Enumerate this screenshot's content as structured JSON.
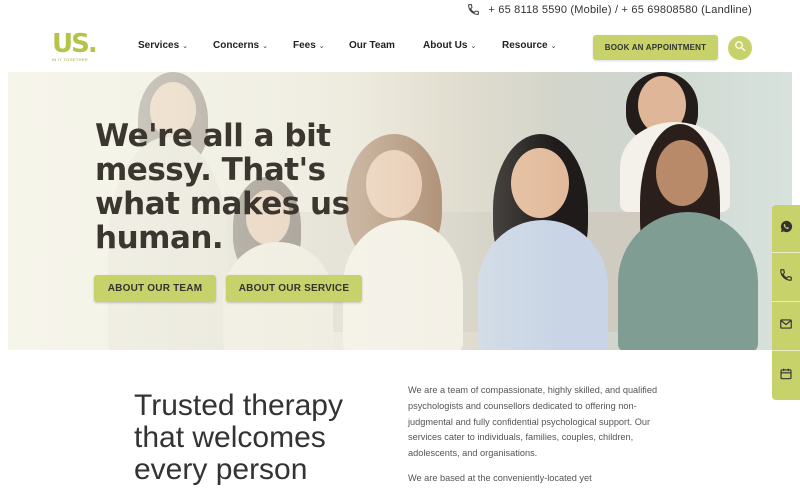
{
  "topbar": {
    "phone_text": "+ 65 8118 5590 (Mobile) / + 65 69808580 (Landline)",
    "phone_icon": "phone-icon"
  },
  "logo": {
    "mark": "US.",
    "tagline": "IN IT TOGETHER"
  },
  "nav": [
    {
      "label": "Services",
      "has_dropdown": true
    },
    {
      "label": "Concerns",
      "has_dropdown": true
    },
    {
      "label": "Fees",
      "has_dropdown": true
    },
    {
      "label": "Our Team",
      "has_dropdown": false
    },
    {
      "label": "About Us",
      "has_dropdown": true
    },
    {
      "label": "Resource",
      "has_dropdown": true
    }
  ],
  "header": {
    "book_label": "BOOK AN APPOINTMENT",
    "search_icon": "search-icon"
  },
  "hero": {
    "title": "We're all a bit messy. That's what makes us human.",
    "btn_team": "ABOUT OUR TEAM",
    "btn_service": "ABOUT OUR SERVICE"
  },
  "side_contact": [
    "whatsapp-icon",
    "phone-icon",
    "mail-icon",
    "calendar-icon"
  ],
  "section": {
    "heading": "Trusted therapy that welcomes every person",
    "para1": "We are a team of compassionate, highly skilled, and qualified psychologists and counsellors dedicated to offering non-judgmental and fully confidential psychological support. Our services cater to individuals, families, couples, children, adolescents, and organisations.",
    "para2": "We are based at the conveniently-located yet"
  },
  "colors": {
    "accent": "#c7d26a",
    "text_dark": "#3b3630"
  }
}
